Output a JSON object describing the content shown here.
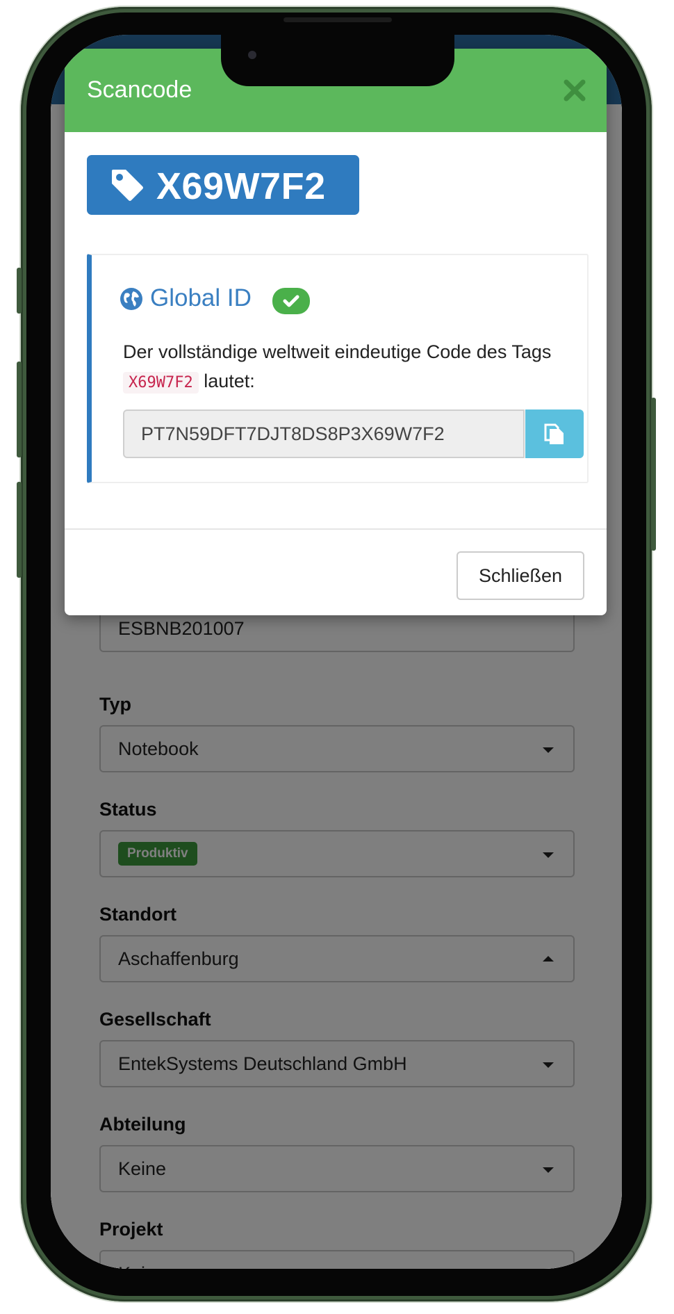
{
  "modal": {
    "title": "Scancode",
    "tag_code": "X69W7F2",
    "global_id_title": "Global ID",
    "description_before": "Der vollständige weltweit eindeutige Code des Tags",
    "description_code": "X69W7F2",
    "description_after": "lautet:",
    "global_id_value": "PT7N59DFT7DJT8DS8P3X69W7F2",
    "close_button": "Schließen"
  },
  "form": {
    "hidden_value": "ESBNB201007",
    "fields": [
      {
        "label": "Typ",
        "value": "Notebook"
      },
      {
        "label": "Status",
        "value": "Produktiv"
      },
      {
        "label": "Standort",
        "value": "Aschaffenburg"
      },
      {
        "label": "Gesellschaft",
        "value": "EntekSystems Deutschland GmbH"
      },
      {
        "label": "Abteilung",
        "value": "Keine"
      },
      {
        "label": "Projekt",
        "value": "Keine"
      }
    ]
  },
  "colors": {
    "modal_header": "#5cb85c",
    "tag_badge": "#2f7bbf",
    "copy_button": "#5bc0de",
    "status_badge": "#3c9a3c"
  },
  "icons": {
    "tag": "tag-icon",
    "globe": "globe-icon",
    "check": "check-icon",
    "copy": "copy-icon",
    "close": "close-icon"
  }
}
